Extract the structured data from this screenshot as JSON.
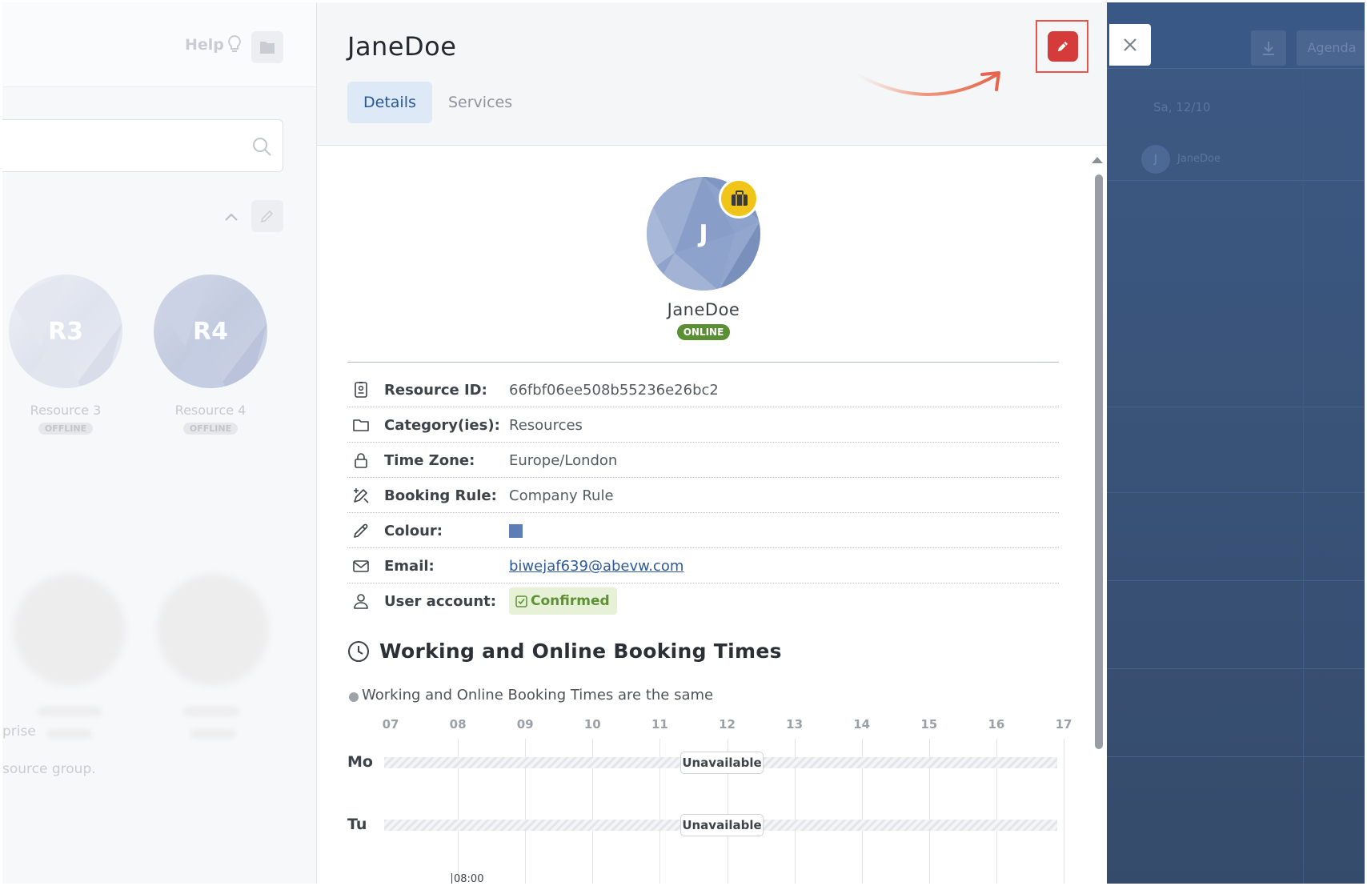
{
  "left_panel": {
    "help_label": "Help",
    "resources": [
      {
        "initials": "R3",
        "name": "Resource 3",
        "status": "OFFLINE"
      },
      {
        "initials": "R4",
        "name": "Resource 4",
        "status": "OFFLINE"
      }
    ],
    "fragment_text_1": "prise",
    "fragment_text_2": "source group."
  },
  "right_panel": {
    "agenda_label": "Agenda",
    "date_label": "Sa, 12/10",
    "avatar_initial": "J",
    "resource_name": "JaneDoe"
  },
  "modal": {
    "title": "JaneDoe",
    "tabs": [
      {
        "label": "Details",
        "active": true
      },
      {
        "label": "Services",
        "active": false
      }
    ],
    "profile": {
      "initial": "J",
      "name": "JaneDoe",
      "status": "ONLINE"
    },
    "details": [
      {
        "icon": "id-badge-icon",
        "label": "Resource ID:",
        "value": "66fbf06ee508b55236e26bc2"
      },
      {
        "icon": "folder-icon",
        "label": "Category(ies):",
        "value": "Resources"
      },
      {
        "icon": "lock-icon",
        "label": "Time Zone:",
        "value": "Europe/London"
      },
      {
        "icon": "booking-rule-icon",
        "label": "Booking Rule:",
        "value": "Company Rule"
      },
      {
        "icon": "eyedropper-icon",
        "label": "Colour:",
        "value": "#5e7db4"
      },
      {
        "icon": "envelope-icon",
        "label": "Email:",
        "value": "biwejaf639@abevw.com"
      },
      {
        "icon": "user-icon",
        "label": "User account:",
        "value": "Confirmed"
      }
    ],
    "working_times": {
      "title": "Working and Online Booking Times",
      "note": "Working and Online Booking Times are the same",
      "hours": [
        "07",
        "08",
        "09",
        "10",
        "11",
        "12",
        "13",
        "14",
        "15",
        "16",
        "17"
      ],
      "days": [
        {
          "label": "Mo",
          "status": "Unavailable"
        },
        {
          "label": "Tu",
          "status": "Unavailable"
        }
      ],
      "time_marker": "08:00"
    }
  },
  "colors": {
    "accent_blue": "#2a5794",
    "edit_red": "#d63b3b",
    "online_green": "#5b8f33",
    "highlight_red": "#e8554a"
  }
}
